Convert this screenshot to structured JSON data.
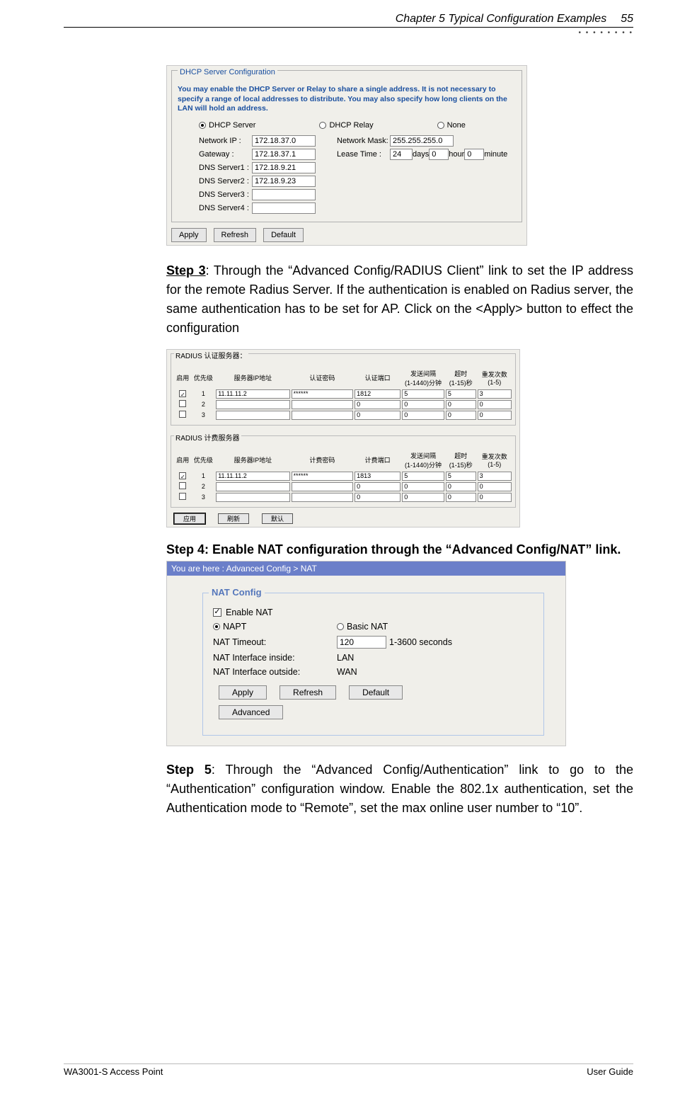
{
  "header": {
    "chapter": "Chapter 5 Typical Configuration Examples",
    "page": "55"
  },
  "dhcp": {
    "legend": "DHCP Server Configuration",
    "note": "You may enable the DHCP Server or Relay to share a single address. It is not necessary to specify a range of local addresses to distribute. You may also specify how long clients on the LAN will hold an address.",
    "mode": {
      "server": "DHCP Server",
      "relay": "DHCP Relay",
      "none": "None"
    },
    "labels": {
      "network_ip": "Network IP :",
      "network_mask": "Network Mask:",
      "gateway": "Gateway :",
      "lease_time": "Lease Time :",
      "days": "days",
      "hour": "hour",
      "minute": "minute",
      "dns1": "DNS Server1 :",
      "dns2": "DNS Server2 :",
      "dns3": "DNS Server3 :",
      "dns4": "DNS Server4 :"
    },
    "values": {
      "network_ip": "172.18.37.0",
      "network_mask": "255.255.255.0",
      "gateway": "172.18.37.1",
      "lease_days": "24",
      "lease_hour": "0",
      "lease_minute": "0",
      "dns1": "172.18.9.21",
      "dns2": "172.18.9.23",
      "dns3": "",
      "dns4": ""
    },
    "buttons": {
      "apply": "Apply",
      "refresh": "Refresh",
      "default": "Default"
    }
  },
  "step3": {
    "label": "Step 3",
    "text": ": Through the “Advanced Config/RADIUS Client” link to set the IP address for the remote Radius Server. If the authentication is enabled on Radius server, the same authentication has to be set for AP. Click on the <Apply> button to effect the configuration"
  },
  "radius": {
    "auth_legend": "RADIUS 认证服务器：",
    "acct_legend": "RADIUS 计费服务器",
    "headers": {
      "enable": "启用",
      "priority": "优先级",
      "ip": "服务器IP地址",
      "auth_pw": "认证密码",
      "auth_port": "认证端口",
      "acct_pw": "计费密码",
      "acct_port": "计费端口",
      "interval": "发送间隔\n(1-1440)分钟",
      "timeout": "超时\n(1-15)秒",
      "retry": "重发次数\n(1-5)"
    },
    "auth_rows": [
      {
        "en": true,
        "pri": "1",
        "ip": "11.11.11.2",
        "pw": "******",
        "port": "1812",
        "intv": "5",
        "to": "5",
        "rt": "3"
      },
      {
        "en": false,
        "pri": "2",
        "ip": "",
        "pw": "",
        "port": "0",
        "intv": "0",
        "to": "0",
        "rt": "0"
      },
      {
        "en": false,
        "pri": "3",
        "ip": "",
        "pw": "",
        "port": "0",
        "intv": "0",
        "to": "0",
        "rt": "0"
      }
    ],
    "acct_rows": [
      {
        "en": true,
        "pri": "1",
        "ip": "11.11.11.2",
        "pw": "******",
        "port": "1813",
        "intv": "5",
        "to": "5",
        "rt": "3"
      },
      {
        "en": false,
        "pri": "2",
        "ip": "",
        "pw": "",
        "port": "0",
        "intv": "0",
        "to": "0",
        "rt": "0"
      },
      {
        "en": false,
        "pri": "3",
        "ip": "",
        "pw": "",
        "port": "0",
        "intv": "0",
        "to": "0",
        "rt": "0"
      }
    ],
    "buttons": {
      "apply": "应用",
      "refresh": "刷新",
      "default": "默认"
    }
  },
  "step4": {
    "text": "Step 4: Enable NAT configuration through the “Advanced Config/NAT” link."
  },
  "nat": {
    "breadcrumb": "You are here : Advanced Config > NAT",
    "legend": "NAT Config",
    "enable": "Enable NAT",
    "napt": "NAPT",
    "basic": "Basic NAT",
    "timeout_label": "NAT Timeout:",
    "timeout_value": "120",
    "timeout_suffix": "1-3600 seconds",
    "inside_label": "NAT Interface inside:",
    "inside_value": "LAN",
    "outside_label": "NAT Interface outside:",
    "outside_value": "WAN",
    "buttons": {
      "apply": "Apply",
      "refresh": "Refresh",
      "default": "Default",
      "advanced": "Advanced"
    }
  },
  "step5": {
    "label": "Step 5",
    "text": ": Through the “Advanced Config/Authentication” link to go to the “Authentication” configuration window. Enable the 802.1x authentication, set the Authentication mode to “Remote”, set the max online user number to “10”."
  },
  "footer": {
    "left": "WA3001-S Access Point",
    "right": "User Guide"
  }
}
